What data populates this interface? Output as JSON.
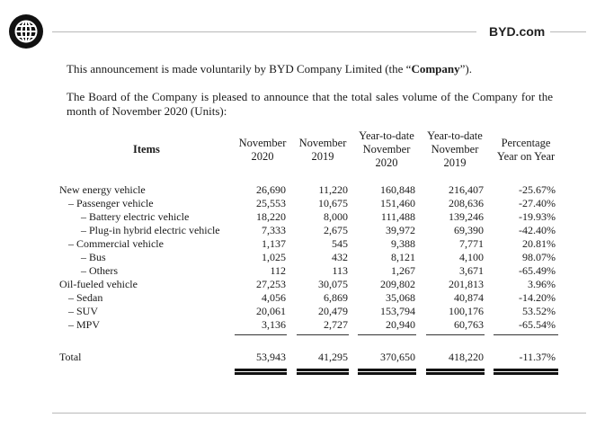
{
  "header": {
    "site": "BYD.com"
  },
  "intro": {
    "line1_prefix": "This announcement is made voluntarily by BYD Company Limited (the “",
    "line1_bold": "Company",
    "line1_suffix": "”).",
    "line2": "The Board of the Company is pleased to announce that the total sales volume of the Company for the month of November 2020 (Units):"
  },
  "table": {
    "columns": [
      {
        "line1": "Items",
        "line2": "",
        "line3": ""
      },
      {
        "line1": "November",
        "line2": "2020",
        "line3": ""
      },
      {
        "line1": "November",
        "line2": "2019",
        "line3": ""
      },
      {
        "line1": "Year-to-date",
        "line2": "November",
        "line3": "2020"
      },
      {
        "line1": "Year-to-date",
        "line2": "November",
        "line3": "2019"
      },
      {
        "line1": "Percentage",
        "line2": "Year on Year",
        "line3": ""
      }
    ],
    "rows": [
      {
        "label": "New energy vehicle",
        "values": [
          "26,690",
          "11,220",
          "160,848",
          "216,407",
          "-25.67%"
        ]
      },
      {
        "label": "– Passenger vehicle",
        "values": [
          "25,553",
          "10,675",
          "151,460",
          "208,636",
          "-27.40%"
        ]
      },
      {
        "label": "– Battery electric vehicle",
        "values": [
          "18,220",
          "8,000",
          "111,488",
          "139,246",
          "-19.93%"
        ]
      },
      {
        "label": "– Plug-in hybrid electric vehicle",
        "values": [
          "7,333",
          "2,675",
          "39,972",
          "69,390",
          "-42.40%"
        ]
      },
      {
        "label": "– Commercial vehicle",
        "values": [
          "1,137",
          "545",
          "9,388",
          "7,771",
          "20.81%"
        ]
      },
      {
        "label": "– Bus",
        "values": [
          "1,025",
          "432",
          "8,121",
          "4,100",
          "98.07%"
        ]
      },
      {
        "label": "– Others",
        "values": [
          "112",
          "113",
          "1,267",
          "3,671",
          "-65.49%"
        ]
      },
      {
        "label": "Oil-fueled vehicle",
        "values": [
          "27,253",
          "30,075",
          "209,802",
          "201,813",
          "3.96%"
        ]
      },
      {
        "label": "– Sedan",
        "values": [
          "4,056",
          "6,869",
          "35,068",
          "40,874",
          "-14.20%"
        ]
      },
      {
        "label": "– SUV",
        "values": [
          "20,061",
          "20,479",
          "153,794",
          "100,176",
          "53.52%"
        ]
      },
      {
        "label": "– MPV",
        "values": [
          "3,136",
          "2,727",
          "20,940",
          "60,763",
          "-65.54%"
        ]
      }
    ],
    "total": {
      "label": "Total",
      "values": [
        "53,943",
        "41,295",
        "370,650",
        "418,220",
        "-11.37%"
      ]
    }
  }
}
